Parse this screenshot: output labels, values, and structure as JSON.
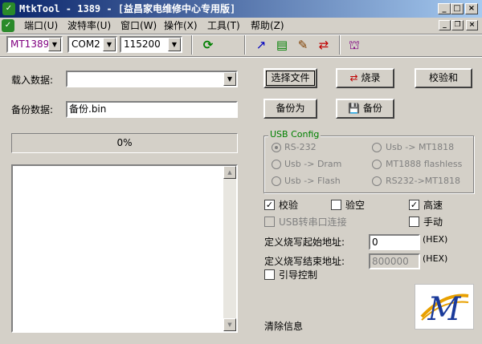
{
  "window": {
    "title": "MtkTool - 1389 - [益昌家电维修中心专用版]",
    "minimize": "_",
    "maximize": "□",
    "close": "×"
  },
  "menu": {
    "items": [
      "端口(U)",
      "波特率(U)",
      "窗口(W)",
      "操作(X)",
      "工具(T)",
      "帮助(Z)"
    ]
  },
  "toolbar": {
    "chip": "MT1389",
    "port": "COM2",
    "baud": "115200"
  },
  "load": {
    "label": "载入数据:",
    "value": "",
    "select_file": "选择文件",
    "burn": "烧录",
    "checksum": "校验和"
  },
  "backup": {
    "label": "备份数据:",
    "value": "备份.bin",
    "backup_as": "备份为",
    "backup": "备份"
  },
  "progress": {
    "text": "0%",
    "value": 0
  },
  "usb_config": {
    "title": "USB Config",
    "options": [
      "RS-232",
      "Usb -> MT1818",
      "Usb -> Dram",
      "MT1888 flashless",
      "Usb -> Flash",
      "RS232->MT1818"
    ],
    "selected": "RS-232"
  },
  "options": {
    "verify": "校验",
    "blank_check": "验空",
    "high_speed": "高速",
    "usb_serial": "USB转串口连接",
    "manual": "手动",
    "boot_control": "引导控制"
  },
  "address": {
    "start_label": "定义烧写起始地址:",
    "start_value": "0",
    "start_unit": "(HEX)",
    "end_label": "定义烧写结束地址:",
    "end_value": "800000",
    "end_unit": "(HEX)"
  },
  "clear_info": "清除信息",
  "logo_letter": "M",
  "colors": {
    "titlebar_start": "#0a246a",
    "group_title": "#008000",
    "face": "#d4d0c8"
  }
}
